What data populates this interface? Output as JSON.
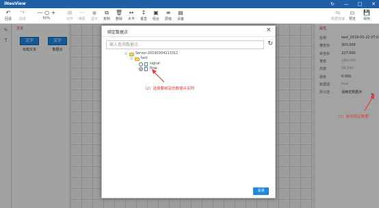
{
  "app": {
    "title": "iNeuView",
    "window_controls": [
      "↻",
      "—",
      "□",
      "✕"
    ]
  },
  "toolbar": {
    "left_items": [
      {
        "label": "回退",
        "icon": "↶",
        "icon_name": "undo-icon",
        "dim": false
      },
      {
        "label": "前进",
        "icon": "↷",
        "icon_name": "redo-icon",
        "dim": true
      }
    ],
    "zoom": {
      "value": "50%",
      "icons": "— ○ +"
    },
    "right_items": [
      {
        "label": "对齐",
        "icon": "⊞",
        "icon_name": "align-icon",
        "dim": true
      },
      {
        "label": "等距",
        "icon": "⋯",
        "icon_name": "distribute-icon",
        "dim": true
      },
      {
        "label": "显示",
        "icon": "◉",
        "icon_name": "eye-icon",
        "dim": true
      },
      {
        "label": "复制",
        "icon": "⧉",
        "icon_name": "copy-icon",
        "dim": false
      },
      {
        "label": "删除",
        "icon": "🗑",
        "icon_name": "delete-icon",
        "dim": false
      },
      {
        "label": "水平",
        "icon": "↔",
        "icon_name": "horizontal-icon",
        "dim": false
      },
      {
        "label": "垂直",
        "icon": "↕",
        "icon_name": "vertical-icon",
        "dim": false
      },
      {
        "label": "组合",
        "icon": "▣",
        "icon_name": "group-icon",
        "dim": false
      },
      {
        "label": "层级",
        "icon": "≡",
        "icon_name": "layer-icon",
        "dim": false
      },
      {
        "label": "设备",
        "icon": "▤",
        "icon_name": "device-icon",
        "dim": false
      }
    ],
    "far_right": [
      {
        "label": "数据连接",
        "icon": "⇆",
        "icon_name": "data-connection-icon",
        "dim": true
      },
      {
        "label": "预览",
        "icon": "▭",
        "icon_name": "preview-icon",
        "dim": false
      },
      {
        "label": "保存",
        "icon": "💾",
        "icon_name": "save-icon",
        "dim": false
      }
    ]
  },
  "library": {
    "header": "文本",
    "components": [
      {
        "box_label": "文字",
        "caption": "标题文本"
      },
      {
        "box_label": "文字",
        "caption": "数据点"
      }
    ]
  },
  "properties": {
    "header": "属性",
    "rows": [
      {
        "key": "名称",
        "value": "text_2019-05-22 07:0",
        "gray": false
      },
      {
        "key": "横坐标",
        "value": "303.000",
        "gray": false
      },
      {
        "key": "纵坐标",
        "value": "227.000",
        "gray": false
      },
      {
        "key": "宽度",
        "value": "180.000",
        "gray": true
      },
      {
        "key": "高度",
        "value": "28.340",
        "gray": true
      },
      {
        "key": "旋转",
        "value": "0.000",
        "gray": false
      },
      {
        "key": "数据源",
        "value": "flow",
        "gray": true
      },
      {
        "key": "默认值",
        "value": "请绑定数据点",
        "gray": false
      }
    ]
  },
  "dialog": {
    "title": "绑定数据点",
    "close": "×",
    "search_placeholder": "输入查询数据点",
    "refresh": "↻",
    "tree": {
      "root": {
        "toggle": "⊟",
        "label": "Server-20190304213311"
      },
      "folder": {
        "toggle": "⊟",
        "label": "test"
      },
      "leaves": [
        {
          "label": "signal",
          "selected": false
        },
        {
          "label": "flow",
          "selected": true
        }
      ]
    },
    "ok_label": "关闭"
  },
  "annotations": {
    "step1": "（1）单击绑定数据",
    "step2": "（2）选择要绑定的数据点名称"
  },
  "colors": {
    "titlebar": "#1f5fa6",
    "accent": "#1e88e5",
    "annotation": "#e53935"
  }
}
